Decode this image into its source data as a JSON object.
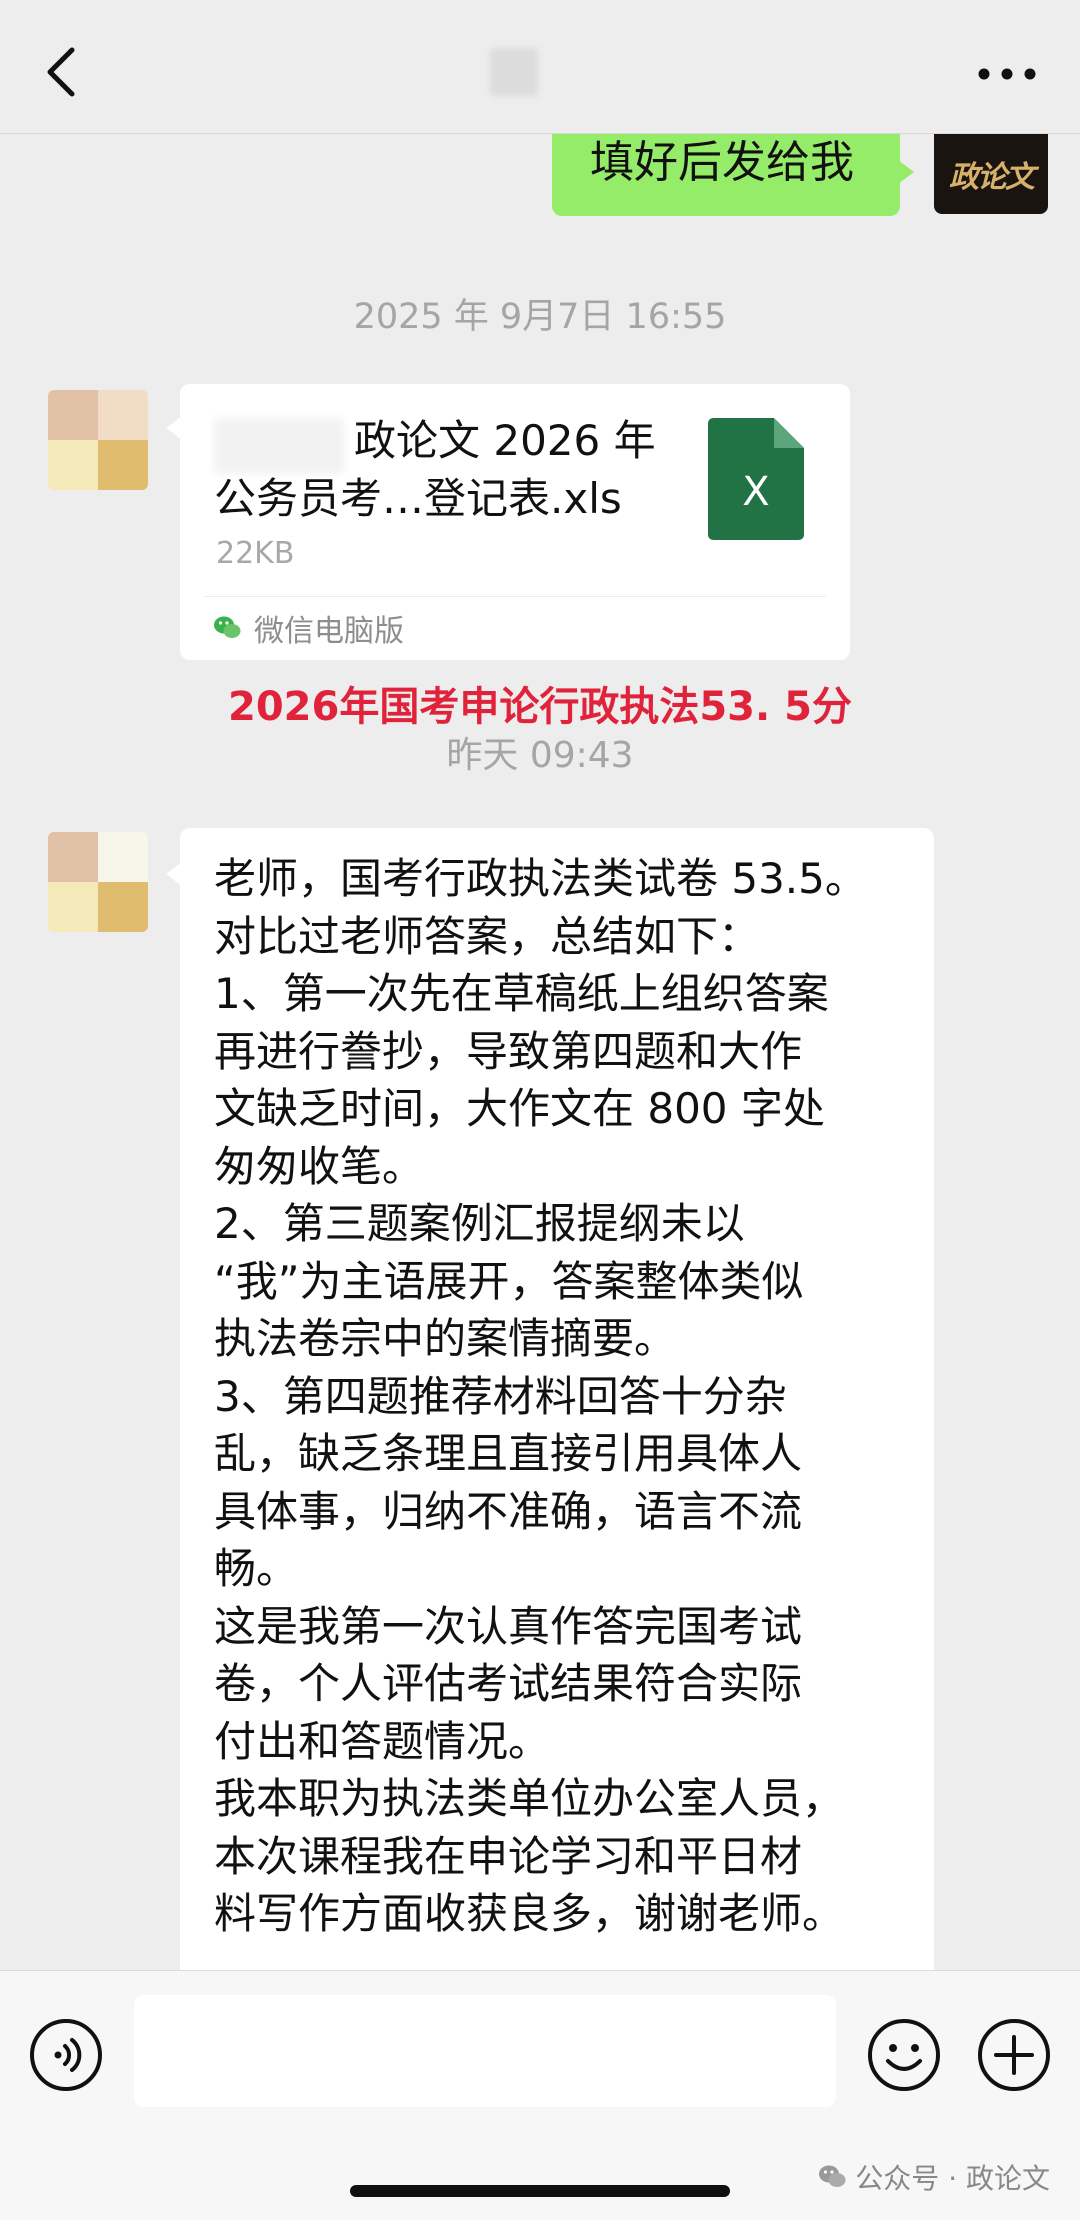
{
  "header": {
    "back_label": "back",
    "more_label": "more"
  },
  "messages": {
    "mine_text": "填好后发给我",
    "mine_avatar_logo": "政论文",
    "timestamp_1": "2025 年 9月7日 16:55",
    "file": {
      "name_line1": "政论文 2026 年",
      "name_line2": "公务员考…登记表.xls",
      "size": "22KB",
      "icon_letter": "X",
      "source": "微信电脑版",
      "icon_color": "#217346"
    },
    "annotation": "2026年国考申论行政执法53. 5分",
    "timestamp_2": "昨天 09:43",
    "text_lines": [
      "老师，国考行政执法类试卷 53.5。",
      "对比过老师答案，总结如下：",
      "1、第一次先在草稿纸上组织答案",
      "再进行誊抄，导致第四题和大作",
      "文缺乏时间，大作文在 800 字处",
      "匆匆收笔。",
      "2、第三题案例汇报提纲未以",
      "“我”为主语展开，答案整体类似",
      "执法卷宗中的案情摘要。",
      "3、第四题推荐材料回答十分杂",
      "乱，缺乏条理且直接引用具体人",
      "具体事，归纳不准确，语言不流",
      "畅。",
      "这是我第一次认真作答完国考试",
      "卷，个人评估考试结果符合实际",
      "付出和答题情况。",
      "我本职为执法类单位办公室人员，",
      "本次课程我在申论学习和平日材",
      "料写作方面收获良多，谢谢老师。"
    ]
  },
  "input": {
    "value": "",
    "placeholder": ""
  },
  "watermark": "公众号 · 政论文",
  "colors": {
    "bubble_mine": "#95ec69",
    "annotation": "#e0233a",
    "background": "#ededed"
  },
  "icons": {
    "back": "chevron-left-icon",
    "more": "ellipsis-icon",
    "voice": "voice-icon",
    "emoji": "emoji-icon",
    "plus": "plus-icon",
    "file": "excel-file-icon",
    "wechat": "wechat-icon"
  }
}
